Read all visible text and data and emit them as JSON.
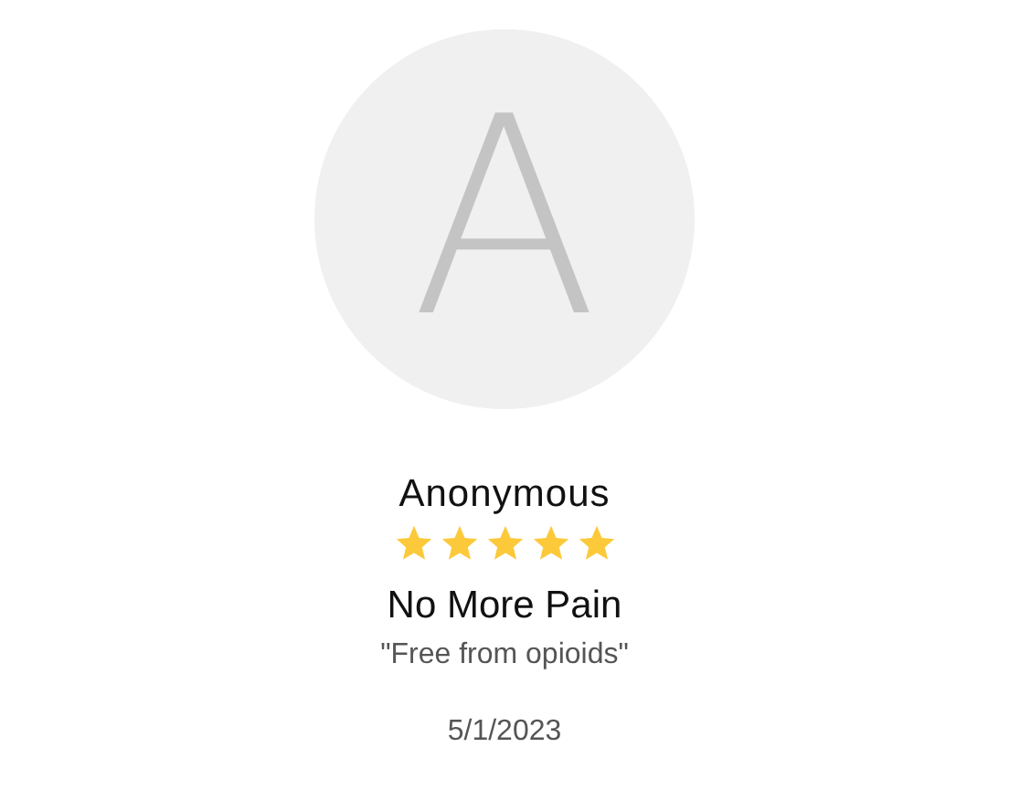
{
  "review": {
    "avatar_initial": "A",
    "author": "Anonymous",
    "stars": 5,
    "title": "No More Pain",
    "quote": "\"Free from opioids\"",
    "date": "5/1/2023"
  }
}
